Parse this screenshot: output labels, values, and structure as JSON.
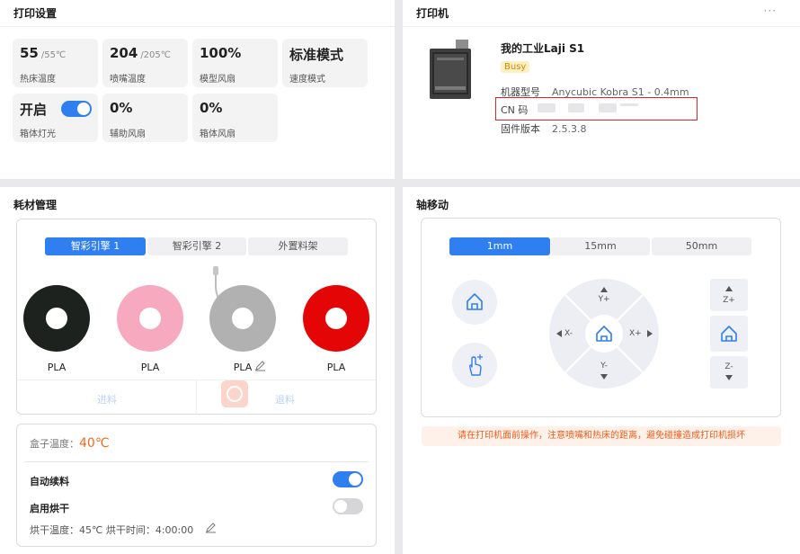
{
  "print_settings": {
    "title": "打印设置",
    "tiles": [
      {
        "value": "55",
        "sub": "/55℃",
        "label": "热床温度"
      },
      {
        "value": "204",
        "sub": "/205℃",
        "label": "喷嘴温度"
      },
      {
        "value": "100%",
        "sub": "",
        "label": "模型风扇"
      },
      {
        "value": "标准模式",
        "sub": "",
        "label": "速度模式"
      },
      {
        "value": "开启",
        "sub": "",
        "label": "箱体灯光"
      },
      {
        "value": "0%",
        "sub": "",
        "label": "辅助风扇"
      },
      {
        "value": "0%",
        "sub": "",
        "label": "箱体风扇"
      }
    ],
    "chamber_light_on": true
  },
  "printer": {
    "title": "打印机",
    "more": "···",
    "name": "我的工业Laji S1",
    "status": "Busy",
    "model_label": "机器型号",
    "model_value": "Anycubic Kobra S1 - 0.4mm",
    "cn_label": "CN 码",
    "firmware_label": "固件版本",
    "firmware_value": "2.5.3.8"
  },
  "filament": {
    "title": "耗材管理",
    "tabs": [
      "智彩引擎 1",
      "智彩引擎 2",
      "外置料架"
    ],
    "active_tab": 0,
    "spools": [
      {
        "color": "#1d221f",
        "type": "PLA"
      },
      {
        "color": "#f6a9bf",
        "type": "PLA"
      },
      {
        "color": "#b1b1b1",
        "type": "PLA"
      },
      {
        "color": "#e40606",
        "type": "PLA"
      }
    ],
    "load": "进料",
    "unload": "退料",
    "box_temp_label": "盒子温度：",
    "box_temp_value": "40℃",
    "auto_refill_label": "自动续料",
    "auto_refill_on": true,
    "drying_label": "启用烘干",
    "drying_on": false,
    "drying_info": "烘干温度：45℃ 烘干时间：4:00:00"
  },
  "axis": {
    "title": "轴移动",
    "steps": [
      "1mm",
      "15mm",
      "50mm"
    ],
    "active_step": 0,
    "dpad": {
      "up": "Y+",
      "down": "Y-",
      "left": "X-",
      "right": "X+"
    },
    "z_up": "Z+",
    "z_down": "Z-",
    "warning": "请在打印机面前操作，注意喷嘴和热床的距离，避免碰撞造成打印机损坏"
  },
  "colors": {
    "accent": "#2f7ff1",
    "warning": "#ef5d1c",
    "temp": "#f26a1b"
  }
}
